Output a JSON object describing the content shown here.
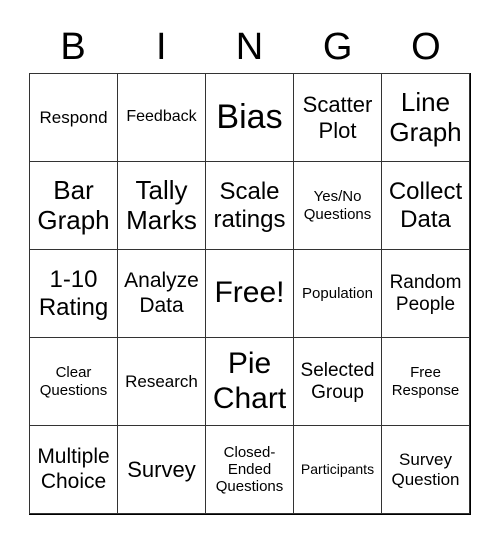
{
  "header": [
    "B",
    "I",
    "N",
    "G",
    "O"
  ],
  "cells": [
    "Respond",
    "Feedback",
    "Bias",
    "Scatter Plot",
    "Line Graph",
    "Bar Graph",
    "Tally Marks",
    "Scale ratings",
    "Yes/No Questions",
    "Collect Data",
    "1-10 Rating",
    "Analyze Data",
    "Free!",
    "Population",
    "Random People",
    "Clear Questions",
    "Research",
    "Pie Chart",
    "Selected Group",
    "Free Response",
    "Multiple Choice",
    "Survey",
    "Closed-Ended Questions",
    "Participants",
    "Survey Question"
  ]
}
